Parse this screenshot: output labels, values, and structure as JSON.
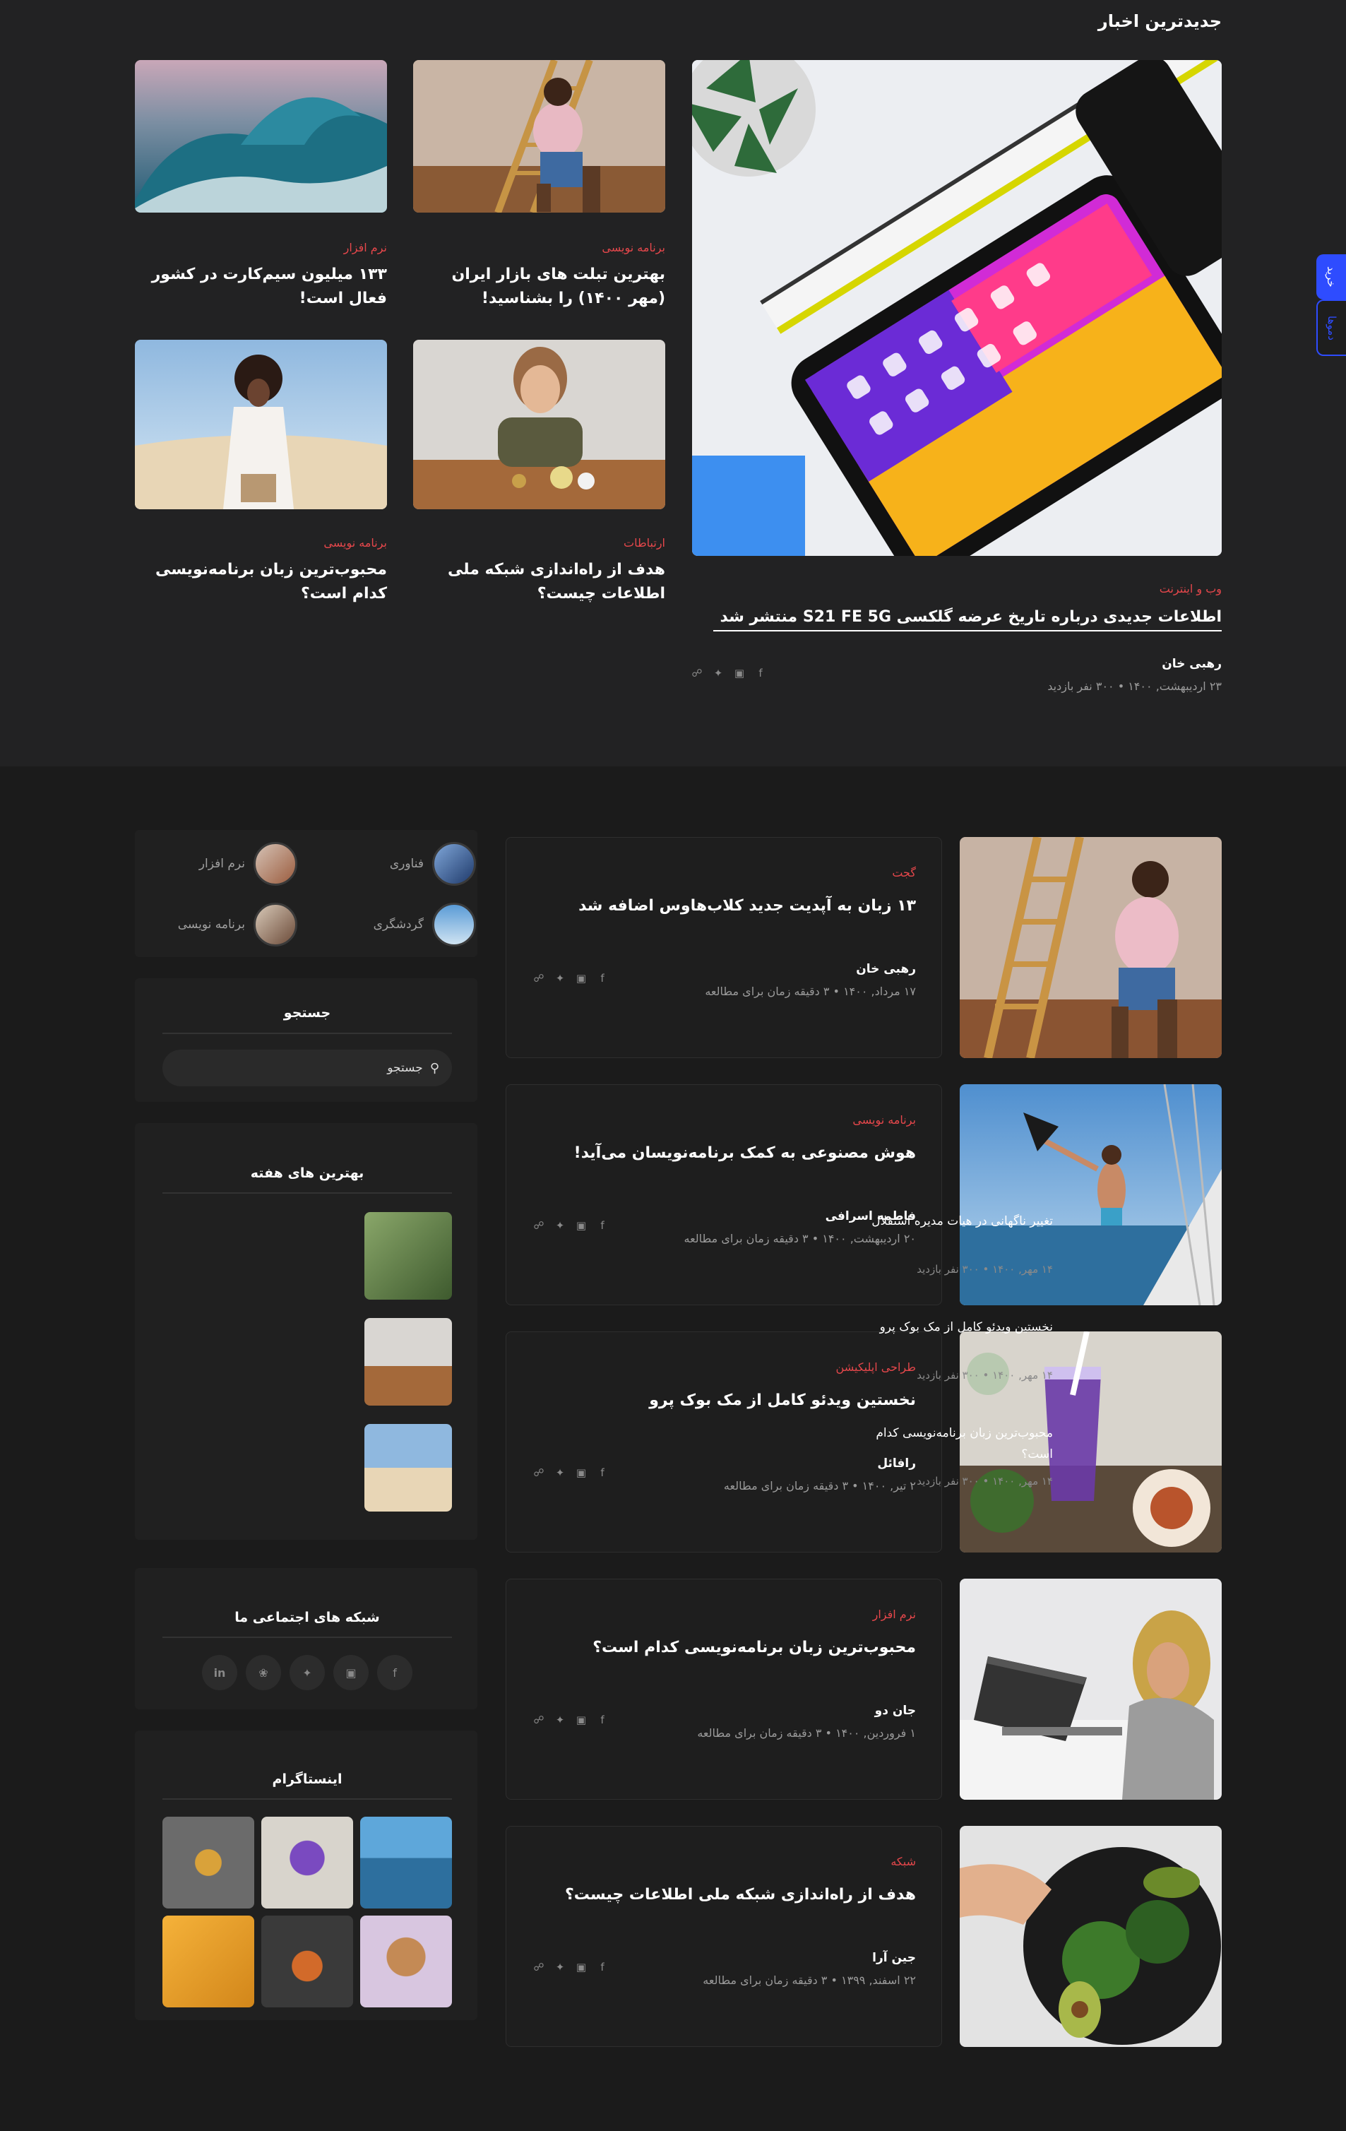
{
  "latest": {
    "section_title": "جدیدترین اخبار",
    "featured": {
      "category": "وب و اینترنت",
      "title": "اطلاعات جدیدی درباره تاریخ عرضه گلکسی S21 FE 5G منتشر شد",
      "author": "رهبی خان",
      "meta": "۲۳ اردیبهشت, ۱۴۰۰ • ۳۰۰ نفر بازدید"
    },
    "grid": [
      {
        "category": "برنامه نویسی",
        "title": "بهترین تبلت های بازار ایران (مهر ۱۴۰۰) را بشناسید!"
      },
      {
        "category": "نرم افزار",
        "title": "۱۳۳ میلیون سیم‌کارت در کشور فعال است!"
      },
      {
        "category": "ارتباطات",
        "title": "هدف از راه‌اندازی شبکه ملی اطلاعات چیست؟"
      },
      {
        "category": "برنامه نویسی",
        "title": "محبوب‌ترین زبان برنامه‌نویسی کدام است؟"
      }
    ]
  },
  "side_pills": {
    "top": "خرید",
    "bottom": "دموها"
  },
  "posts": [
    {
      "category": "گجت",
      "title": "۱۳ زبان به آپدیت جدید کلاب‌هاوس اضافه شد",
      "author": "رهبی خان",
      "meta": "۱۷ مرداد, ۱۴۰۰ • ۳ دقیقه زمان برای مطالعه"
    },
    {
      "category": "برنامه نویسی",
      "title": "هوش مصنوعی به کمک برنامه‌نویسان می‌آید!",
      "author": "فاطمه اسرافی",
      "meta": "۲۰ اردیبهشت, ۱۴۰۰ • ۳ دقیقه زمان برای مطالعه"
    },
    {
      "category": "طراحی اپلیکیشن",
      "title": "نخستین ویدئو کامل از مک بوک پرو",
      "author": "رافائل",
      "meta": "۲ تیر, ۱۴۰۰ • ۳ دقیقه زمان برای مطالعه"
    },
    {
      "category": "نرم افزار",
      "title": "محبوب‌ترین زبان برنامه‌نویسی کدام است؟",
      "author": "جان دو",
      "meta": "۱ فروردین, ۱۴۰۰ • ۳ دقیقه زمان برای مطالعه"
    },
    {
      "category": "شبکه",
      "title": "هدف از راه‌اندازی شبکه ملی اطلاعات چیست؟",
      "author": "جین آرا",
      "meta": "۲۲ اسفند, ۱۳۹۹ • ۳ دقیقه زمان برای مطالعه"
    }
  ],
  "sidebar": {
    "categories": [
      "فناوری",
      "نرم افزار",
      "گردشگری",
      "برنامه نویسی"
    ],
    "search": {
      "title": "جستجو",
      "placeholder": "جستجو"
    },
    "popular": {
      "title": "بهترین های هفته",
      "items": [
        {
          "title": "تغییر ناگهانی در هیات مدیره استقلال",
          "meta": "۱۴ مهر, ۱۴۰۰ • ۳۰۰ نفر بازدید"
        },
        {
          "title": "نخستین ویدئو کامل از مک بوک پرو",
          "meta": "۱۴ مهر, ۱۴۰۰ • ۳۰۰ نفر بازدید"
        },
        {
          "title": "محبوب‌ترین زبان برنامه‌نویسی کدام است؟",
          "meta": "۱۴ مهر, ۱۴۰۰ • ۳۰۰ نفر بازدید"
        }
      ]
    },
    "social": {
      "title": "شبکه های اجتماعی ما",
      "icons": [
        "facebook-icon",
        "instagram-icon",
        "twitter-icon",
        "pinterest-icon",
        "linkedin-icon"
      ]
    },
    "instagram": {
      "title": "اینستاگرام"
    }
  }
}
